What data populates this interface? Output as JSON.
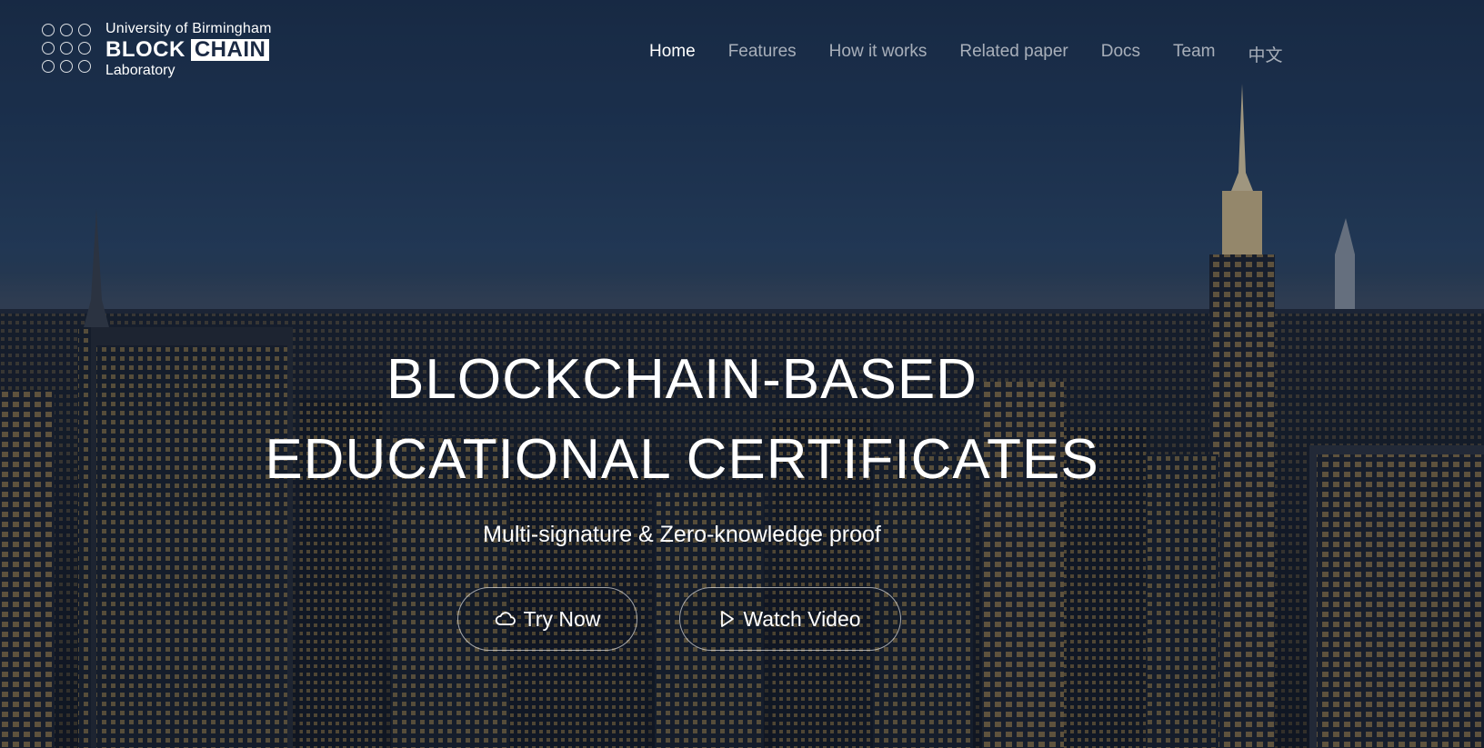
{
  "logo": {
    "line1": "University of Birmingham",
    "block": "BLOCK",
    "chain": "CHAIN",
    "line3": "Laboratory"
  },
  "nav": {
    "items": [
      {
        "label": "Home",
        "active": true
      },
      {
        "label": "Features"
      },
      {
        "label": "How it works"
      },
      {
        "label": "Related paper"
      },
      {
        "label": "Docs"
      },
      {
        "label": "Team"
      },
      {
        "label": "中文"
      }
    ]
  },
  "hero": {
    "headline_line1": "BLOCKCHAIN-BASED",
    "headline_line2": "EDUCATIONAL CERTIFICATES",
    "subtitle": "Multi-signature & Zero-knowledge proof",
    "try_label": "Try Now",
    "try_icon": "cloud-icon",
    "video_label": "Watch Video",
    "video_icon": "play-icon"
  },
  "colors": {
    "accent_text": "#ffffff",
    "nav_inactive": "#a7b0bd",
    "sky_top": "#1d3352"
  }
}
